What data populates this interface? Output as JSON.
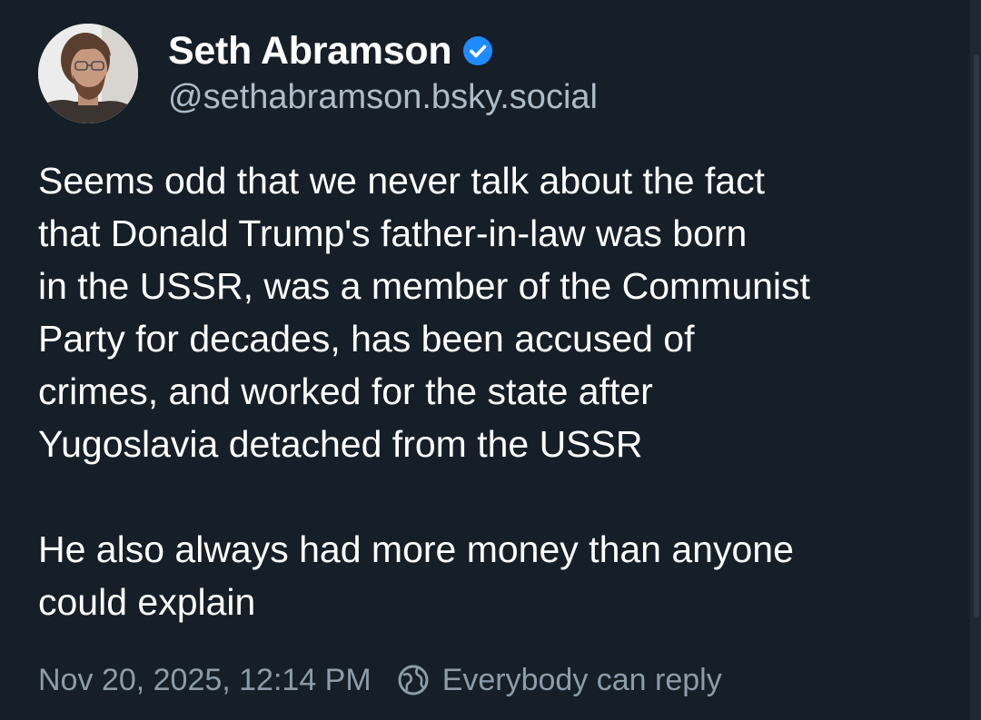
{
  "author": {
    "display_name": "Seth Abramson",
    "handle": "@sethabramson.bsky.social",
    "verified_icon": "verified-checkmark-icon",
    "avatar": "author-avatar-photo"
  },
  "post": {
    "paragraph1_lines": [
      "Seems odd that we never talk about the fact",
      "that Donald Trump's father-in-law was born",
      "in the USSR, was a member of the Communist",
      "Party for decades, has been accused of",
      "crimes, and worked for the state after",
      "Yugoslavia detached from the USSR"
    ],
    "paragraph2_lines": [
      "He also always had more money than anyone",
      "could explain"
    ]
  },
  "meta": {
    "timestamp": "Nov 20, 2025, 12:14 PM",
    "reply_setting_icon": "globe-icon",
    "reply_setting": "Everybody can reply"
  },
  "colors": {
    "background": "#161e27",
    "text_primary": "#ffffff",
    "text_secondary": "#aebbc9",
    "text_meta": "#8d9cab",
    "verified_badge": "#208bfe"
  }
}
